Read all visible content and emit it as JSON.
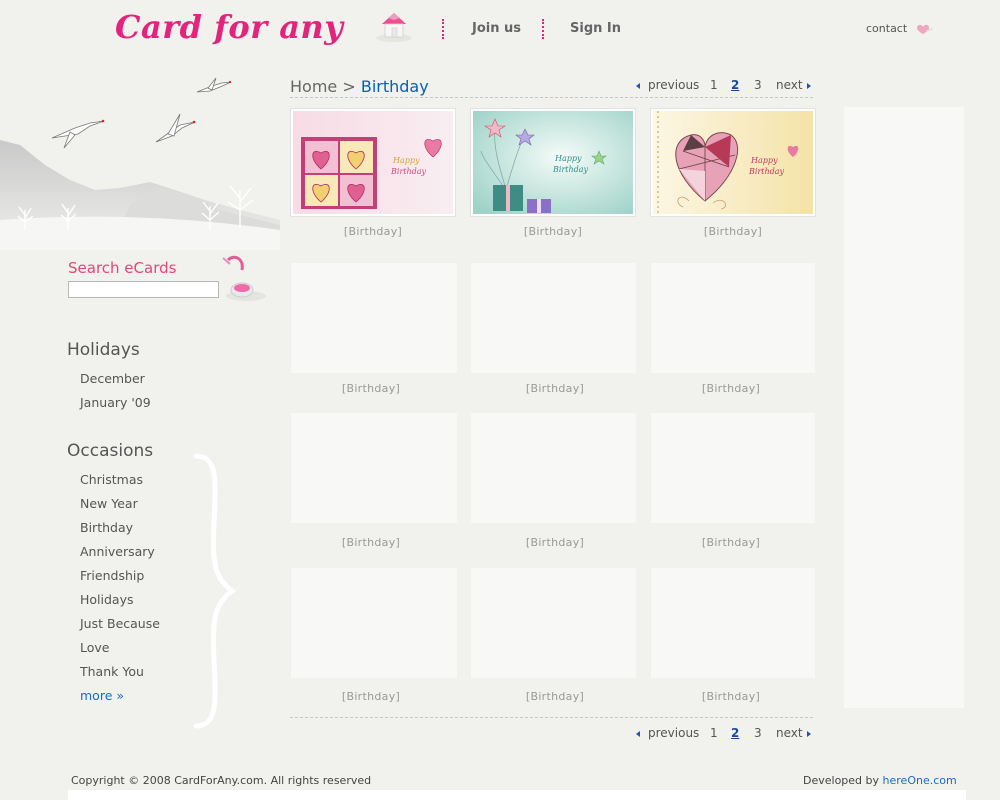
{
  "header": {
    "logo_text": "Card for any",
    "nav": {
      "join": "Join us",
      "signin": "Sign In"
    },
    "contact": "contact"
  },
  "search": {
    "title": "Search eCards",
    "value": "",
    "placeholder": ""
  },
  "sidebar": {
    "holidays_heading": "Holidays",
    "holidays": [
      "December",
      "January '09"
    ],
    "occasions_heading": "Occasions",
    "occasions": [
      "Christmas",
      "New Year",
      "Birthday",
      "Anniversary",
      "Friendship",
      "Holidays",
      "Just Because",
      "Love",
      "Thank You"
    ],
    "more": "more »"
  },
  "breadcrumb": {
    "home": "Home",
    "separator": ">",
    "current": "Birthday"
  },
  "pagination": {
    "previous": "previous",
    "pages": [
      "1",
      "2",
      "3"
    ],
    "current": "2",
    "next": "next"
  },
  "cards": {
    "caption": "[Birthday]",
    "row1": [
      {
        "caption": "[Birthday]",
        "thumb_text": "Happy Birthday"
      },
      {
        "caption": "[Birthday]",
        "thumb_text": "Happy Birthday"
      },
      {
        "caption": "[Birthday]",
        "thumb_text": "Happy Birthday"
      }
    ]
  },
  "footer": {
    "copyright": "Copyright © 2008 CardForAny.com. All rights reserved",
    "developed_by": "Developed by",
    "developer": "hereOne.com"
  },
  "colors": {
    "brand_pink": "#e2247c",
    "link_blue": "#1a6cc0",
    "background": "#f1f1ee"
  }
}
